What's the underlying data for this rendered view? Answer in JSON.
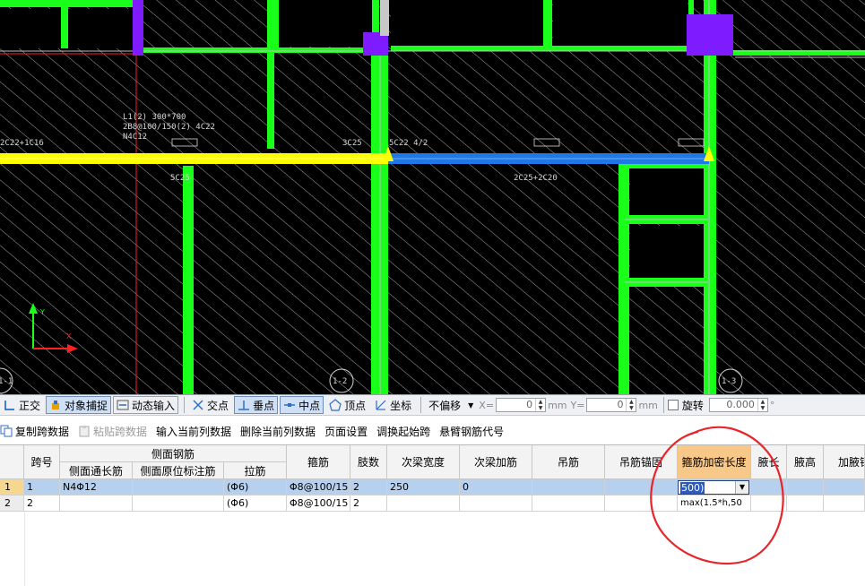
{
  "cad": {
    "labels": [
      "L1(2) 300*700",
      "2B8@100/150(2) 4C22",
      "N4C12",
      "2C22+1C16",
      "3C25",
      "5C22 4/2",
      "5C25",
      "2C25+2C20",
      "1-1",
      "1-2",
      "1-3"
    ],
    "axis": {
      "y": "Y",
      "x": "X"
    }
  },
  "snapbar": {
    "items": [
      {
        "label": "正交"
      },
      {
        "label": "对象捕捉"
      },
      {
        "label": "动态输入"
      },
      {
        "label": "交点"
      },
      {
        "label": "垂点"
      },
      {
        "label": "中点"
      },
      {
        "label": "顶点"
      },
      {
        "label": "坐标"
      }
    ],
    "offset_select": "不偏移",
    "x_label": "X=",
    "x_value": "0",
    "y_label": "Y=",
    "y_value": "0",
    "unit": "mm",
    "rotate_label": "旋转",
    "rotate_value": "0.000",
    "degree": "°"
  },
  "actbar": {
    "items": [
      {
        "label": "复制跨数据",
        "enabled": true
      },
      {
        "label": "粘贴跨数据",
        "enabled": false
      },
      {
        "label": "输入当前列数据",
        "enabled": true
      },
      {
        "label": "删除当前列数据",
        "enabled": true
      },
      {
        "label": "页面设置",
        "enabled": true
      },
      {
        "label": "调换起始跨",
        "enabled": true
      },
      {
        "label": "悬臂钢筋代号",
        "enabled": true
      }
    ]
  },
  "table": {
    "group_header": "侧面钢筋",
    "headers": {
      "span": "跨号",
      "side_long": "侧面通长筋",
      "side_orig": "侧面原位标注筋",
      "tie": "拉筋",
      "stirrup": "箍筋",
      "legs": "肢数",
      "sec_width": "次梁宽度",
      "sec_add": "次梁加筋",
      "hanger": "吊筋",
      "hanger_anchor": "吊筋锚固",
      "dense_len": "箍筋加密长度",
      "haunch_len": "腋长",
      "haunch_h": "腋高",
      "haunch_bar": "加腋钢"
    },
    "rows": [
      {
        "rn": "1",
        "span": "1",
        "side_long": "N4Φ12",
        "side_orig": "",
        "tie": "(Φ6)",
        "stirrup": "Φ8@100/15",
        "legs": "2",
        "sec_width": "250",
        "sec_add": "0",
        "hanger": "",
        "hanger_anchor": "",
        "dense_len": "500)",
        "haunch_len": "",
        "haunch_h": "",
        "haunch_bar": ""
      },
      {
        "rn": "2",
        "span": "2",
        "side_long": "",
        "side_orig": "",
        "tie": "(Φ6)",
        "stirrup": "Φ8@100/15",
        "legs": "2",
        "sec_width": "",
        "sec_add": "",
        "hanger": "",
        "hanger_anchor": "",
        "dense_len": "max(1.5*h,50",
        "haunch_len": "",
        "haunch_h": "",
        "haunch_bar": ""
      }
    ]
  }
}
